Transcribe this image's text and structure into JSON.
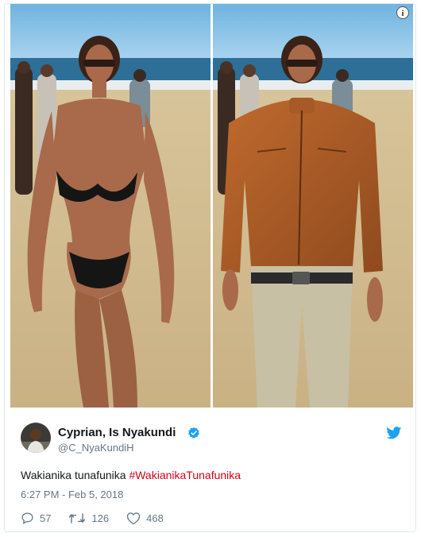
{
  "tweet": {
    "display_name": "Cyprian, Is Nyakundi",
    "handle": "@C_NyaKundiH",
    "text_plain": "Wakianika tunafunika ",
    "hashtag": "#WakianikaTunafunika",
    "timestamp": "6:27 PM - Feb 5, 2018",
    "reply_count": "57",
    "retweet_count": "126",
    "like_count": "468"
  },
  "icons": {
    "info": "info-icon",
    "verified": "verified-badge-icon",
    "brand": "twitter-bird-icon",
    "reply": "reply-icon",
    "retweet": "retweet-icon",
    "like": "heart-icon"
  },
  "colors": {
    "verified": "#1da1f2",
    "brand": "#1da1f2",
    "hashtag": "#d0021b",
    "muted": "#657786"
  }
}
